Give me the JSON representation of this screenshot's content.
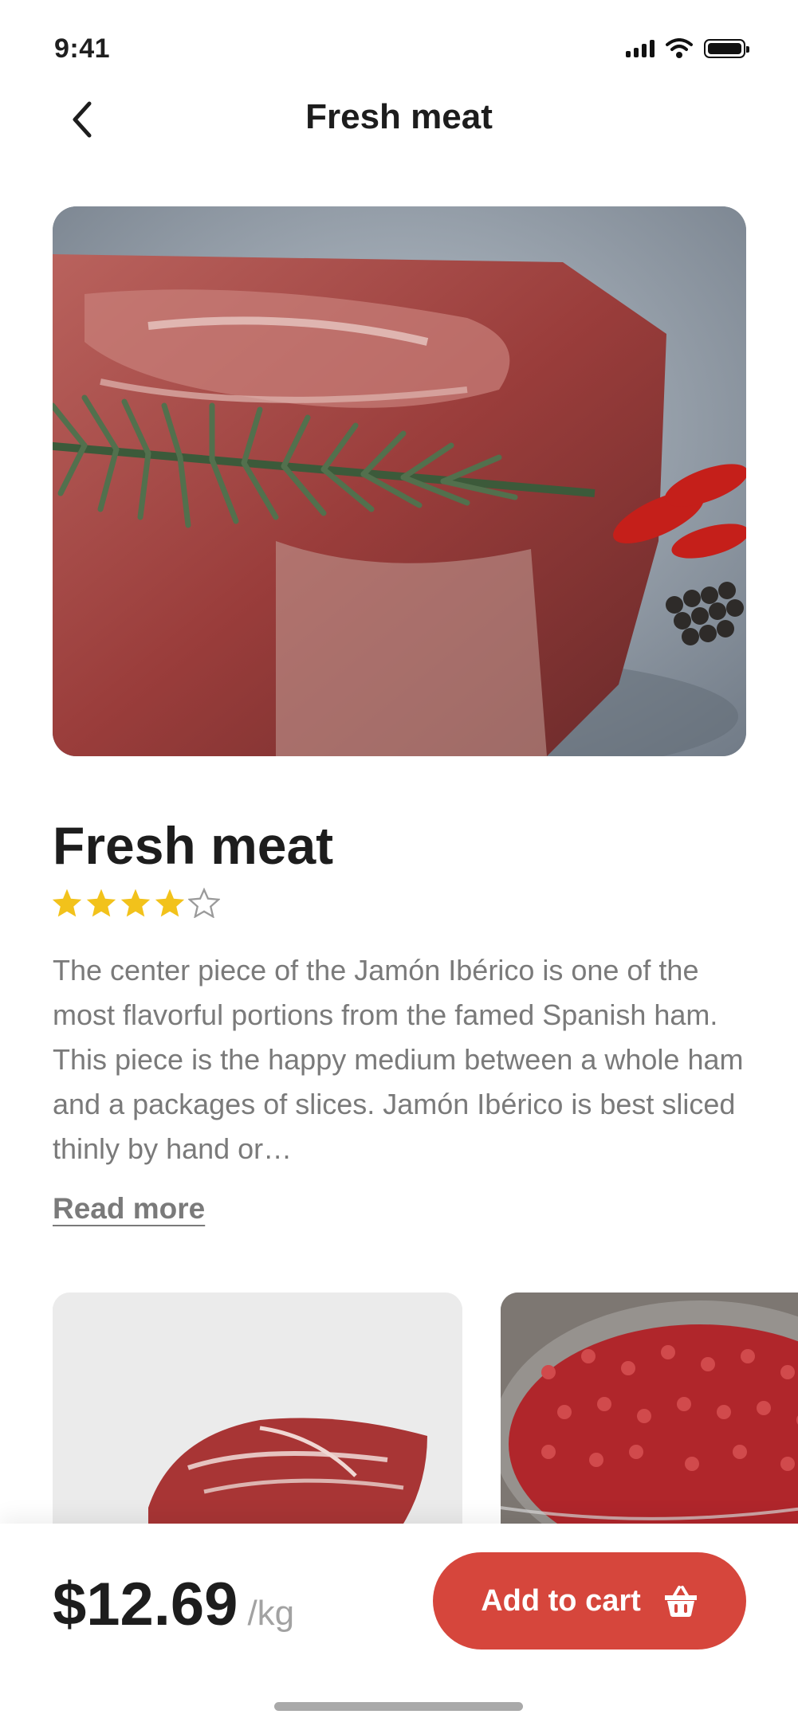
{
  "status_bar": {
    "time": "9:41"
  },
  "header": {
    "title": "Fresh meat"
  },
  "product": {
    "title": "Fresh meat",
    "rating": 4,
    "rating_max": 5,
    "description": "The center piece of the Jamón Ibérico is one of the most flavorful portions from the famed Spanish ham. This piece is the happy medium between a whole ham and a packages of slices. Jamón Ibérico is best sliced thinly by hand or…",
    "read_more_label": "Read more"
  },
  "purchase": {
    "price": "$12.69",
    "unit": "/kg",
    "cart_button_label": "Add to cart"
  },
  "colors": {
    "accent": "#d6463c",
    "star": "#f2c21b",
    "text_primary": "#1d1d1d",
    "text_secondary": "#7a7a7a"
  },
  "icons": [
    "back-chevron-icon",
    "signal-icon",
    "wifi-icon",
    "battery-icon",
    "star-icon",
    "basket-icon"
  ]
}
